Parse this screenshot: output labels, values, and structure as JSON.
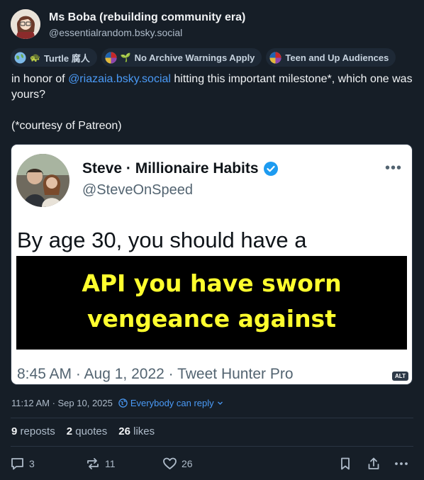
{
  "author": {
    "display_name": "Ms Boba (rebuilding community era)",
    "handle": "@essentialrandom.bsky.social",
    "avatar_icon": "avatar-illustration"
  },
  "labels": [
    {
      "text": "Turtle 腐人",
      "icon": "turtle-icon",
      "glyph": "🐢"
    },
    {
      "text": "No Archive Warnings Apply",
      "icon": "sprout-icon",
      "glyph": "🌱"
    },
    {
      "text": "Teen and Up Audiences",
      "icon": "ao3-icon",
      "glyph": ""
    }
  ],
  "post": {
    "text_before": "in honor of ",
    "mention": "@riazaia.bsky.social",
    "text_after": " hitting this important milestone*, which one was yours?",
    "footnote": "(*courtesy of Patreon)"
  },
  "embed": {
    "tweet_name": "Steve · Millionaire Habits",
    "tweet_handle": "@SteveOnSpeed",
    "tweet_more": "•••",
    "tweet_text": "By age 30, you should have a",
    "meme_line1": "API you have sworn",
    "meme_line2": "vengeance against",
    "tweet_time": "8:45 AM · Aug 1, 2022 · Tweet Hunter Pro",
    "alt_badge": "ALT"
  },
  "meta": {
    "timestamp": "11:12 AM · Sep 10, 2025",
    "reply_setting": "Everybody can reply"
  },
  "stats": {
    "reposts_count": "9",
    "reposts_label": "reposts",
    "quotes_count": "2",
    "quotes_label": "quotes",
    "likes_count": "26",
    "likes_label": "likes"
  },
  "actions": {
    "reply_count": "3",
    "repost_count": "11",
    "like_count": "26"
  },
  "colors": {
    "background": "#161e27",
    "link": "#4a9af6",
    "meme_text": "#ffff2e"
  }
}
